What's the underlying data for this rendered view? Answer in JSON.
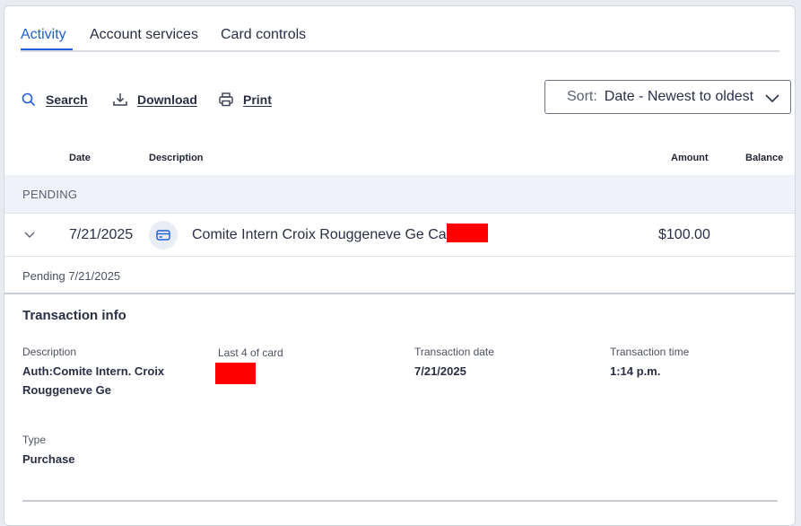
{
  "tabs": [
    {
      "label": "Activity",
      "active": true
    },
    {
      "label": "Account services",
      "active": false
    },
    {
      "label": "Card controls",
      "active": false
    }
  ],
  "toolbar": {
    "search_label": "Search",
    "download_label": "Download",
    "print_label": "Print",
    "sort_label": "Sort:",
    "sort_value": "Date - Newest to oldest"
  },
  "table": {
    "headers": {
      "date": "Date",
      "description": "Description",
      "amount": "Amount",
      "balance": "Balance"
    },
    "pending_label": "PENDING",
    "row": {
      "date": "7/21/2025",
      "description": "Comite Intern Croix Rouggeneve Ge Card",
      "amount": "$100.00",
      "pending_note": "Pending 7/21/2025"
    }
  },
  "transaction_info": {
    "title": "Transaction info",
    "description_label": "Description",
    "description_line1": "Auth:Comite Intern. Croix",
    "description_line2": "Rouggeneve Ge",
    "card_label": "Last 4 of card",
    "date_label": "Transaction date",
    "date_value": "7/21/2025",
    "time_label": "Transaction time",
    "time_value": "1:14 p.m.",
    "type_label": "Type",
    "type_value": "Purchase"
  },
  "colors": {
    "accent": "#1f5ed8",
    "redaction": "#ff0000",
    "band": "#eff2f8"
  },
  "icons": [
    "search-icon",
    "download-icon",
    "print-icon",
    "chevron-down-icon",
    "credit-card-icon"
  ]
}
